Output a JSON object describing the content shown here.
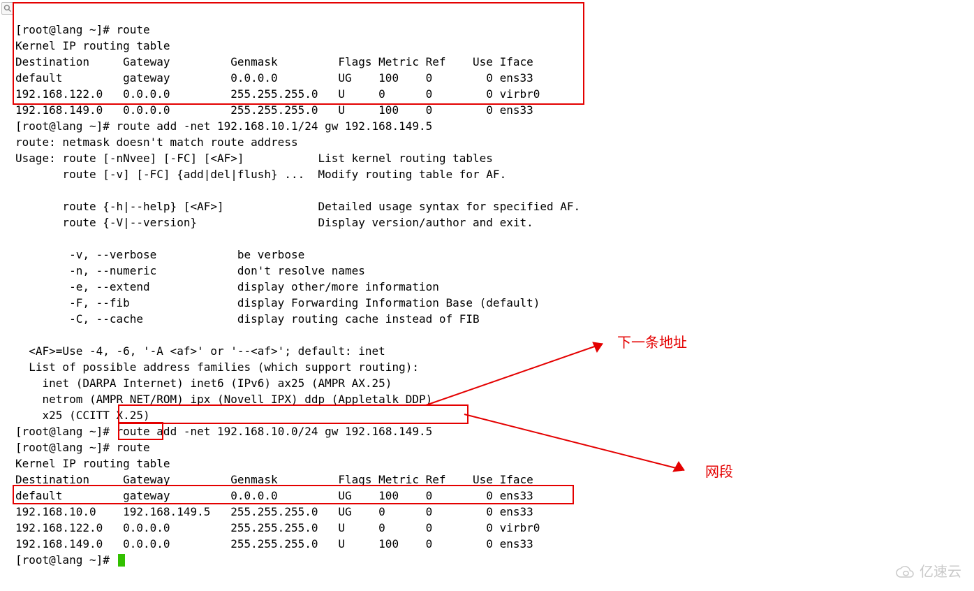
{
  "prompt": "[root@lang ~]# ",
  "cmd_route": "route",
  "route_title": "Kernel IP routing table",
  "route_header": "Destination     Gateway         Genmask         Flags Metric Ref    Use Iface",
  "routes1": [
    "default         gateway         0.0.0.0         UG    100    0        0 ens33",
    "192.168.122.0   0.0.0.0         255.255.255.0   U     0      0        0 virbr0",
    "192.168.149.0   0.0.0.0         255.255.255.0   U     100    0        0 ens33"
  ],
  "cmd_bad": "route add -net 192.168.10.1/24 gw 192.168.149.5",
  "err": "route: netmask doesn't match route address",
  "usage": [
    "Usage: route [-nNvee] [-FC] [<AF>]           List kernel routing tables",
    "       route [-v] [-FC] {add|del|flush} ...  Modify routing table for AF.",
    "",
    "       route {-h|--help} [<AF>]              Detailed usage syntax for specified AF.",
    "       route {-V|--version}                  Display version/author and exit.",
    "",
    "        -v, --verbose            be verbose",
    "        -n, --numeric            don't resolve names",
    "        -e, --extend             display other/more information",
    "        -F, --fib                display Forwarding Information Base (default)",
    "        -C, --cache              display routing cache instead of FIB",
    "",
    "  <AF>=Use -4, -6, '-A <af>' or '--<af>'; default: inet",
    "  List of possible address families (which support routing):",
    "    inet (DARPA Internet) inet6 (IPv6) ax25 (AMPR AX.25) ",
    "    netrom (AMPR NET/ROM) ipx (Novell IPX) ddp (Appletalk DDP) ",
    "    x25 (CCITT X.25) "
  ],
  "cmd_good": "route add -net 192.168.10.0/24 gw 192.168.149.5",
  "routes2": [
    "default         gateway         0.0.0.0         UG    100    0        0 ens33",
    "192.168.10.0    192.168.149.5   255.255.255.0   UG    0      0        0 ens33",
    "192.168.122.0   0.0.0.0         255.255.255.0   U     0      0        0 virbr0",
    "192.168.149.0   0.0.0.0         255.255.255.0   U     100    0        0 ens33"
  ],
  "label_next_hop": "下一条地址",
  "label_netseg": "网段",
  "watermark": "亿速云"
}
